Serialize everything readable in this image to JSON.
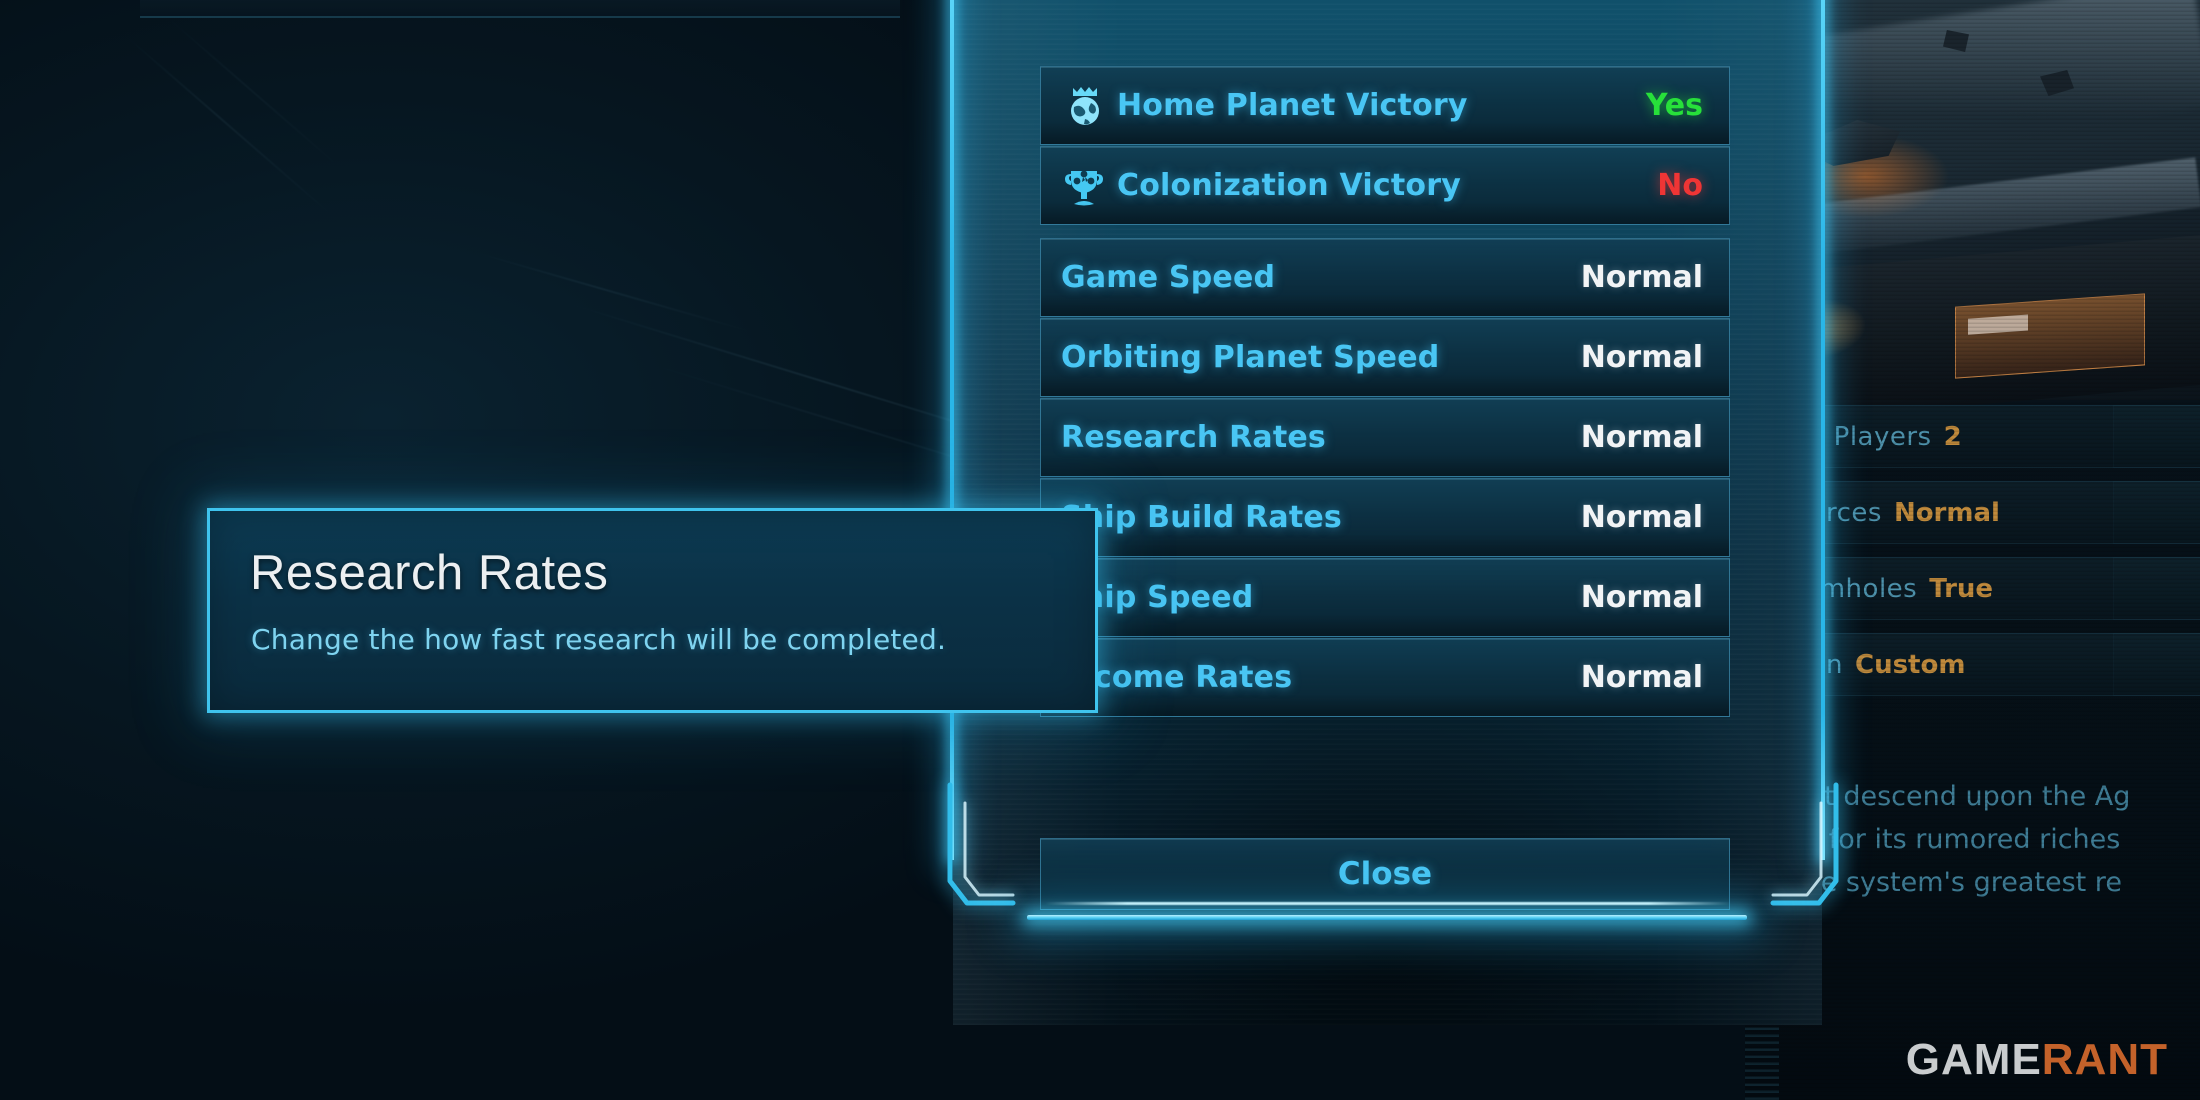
{
  "modal": {
    "victory_conditions": [
      {
        "icon": "crowned-planet-icon",
        "label": "Home Planet Victory",
        "value": "Yes",
        "state": "yes"
      },
      {
        "icon": "trophy-icon",
        "label": "Colonization Victory",
        "value": "No",
        "state": "no"
      }
    ],
    "speed_settings": [
      {
        "label": "Game Speed",
        "value": "Normal"
      },
      {
        "label": "Orbiting Planet Speed",
        "value": "Normal"
      },
      {
        "label": "Research Rates",
        "value": "Normal"
      },
      {
        "label": "Ship Build Rates",
        "value": "Normal"
      },
      {
        "label": "Ship Speed",
        "value": "Normal"
      },
      {
        "label": "Income Rates",
        "value": "Normal"
      }
    ],
    "close_label": "Close"
  },
  "tooltip": {
    "title": "Research Rates",
    "description": "Change the how fast research will be completed."
  },
  "background_panel": {
    "rows": [
      {
        "key": "x Players",
        "value": "2"
      },
      {
        "key": "urces",
        "value": "Normal"
      },
      {
        "key": "rmholes",
        "value": "True"
      },
      {
        "key": "gn",
        "value": "Custom"
      }
    ],
    "description_lines": [
      "ust descend upon the Ag",
      "te for its rumored riches",
      "the system's greatest re"
    ]
  },
  "watermark": {
    "part1": "GAME",
    "part2": "RANT"
  },
  "colors": {
    "accent_cyan": "#49c6f4",
    "frame_glow": "#3fc4ee",
    "value_white": "#f2f4f6",
    "yes_green": "#27e03a",
    "no_red": "#ef3535",
    "bg_gold": "#c08a3c",
    "watermark_orange": "#c4622a"
  }
}
